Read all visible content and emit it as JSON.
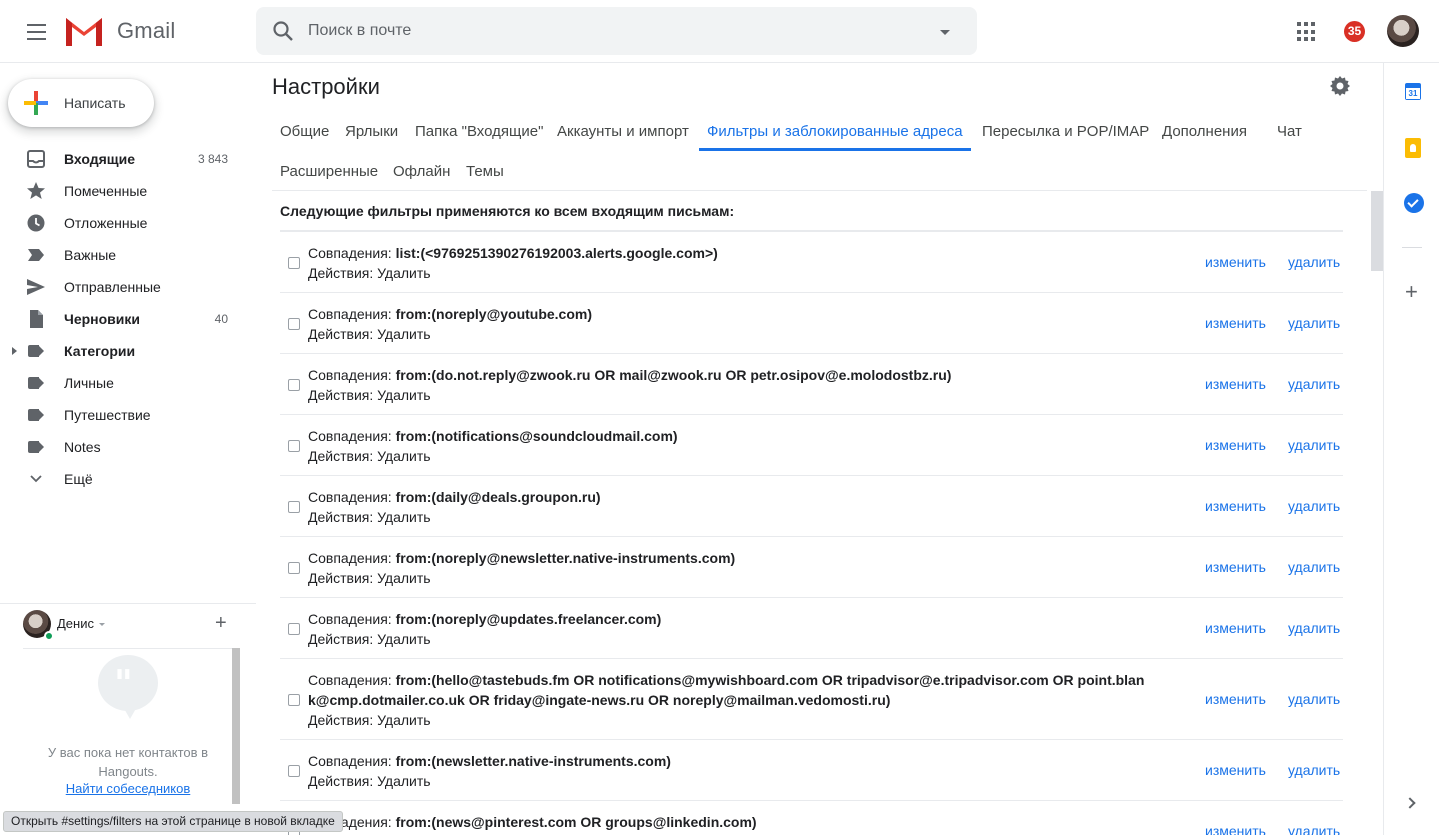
{
  "header": {
    "app_name": "Gmail",
    "search_placeholder": "Поиск в почте",
    "notifications_count": "35"
  },
  "sidebar": {
    "compose_label": "Написать",
    "items": [
      {
        "label": "Входящие",
        "count": "3 843",
        "icon": "inbox-icon",
        "bold": true
      },
      {
        "label": "Помеченные",
        "count": "",
        "icon": "star-icon"
      },
      {
        "label": "Отложенные",
        "count": "",
        "icon": "clock-icon"
      },
      {
        "label": "Важные",
        "count": "",
        "icon": "important-icon"
      },
      {
        "label": "Отправленные",
        "count": "",
        "icon": "send-icon"
      },
      {
        "label": "Черновики",
        "count": "40",
        "icon": "draft-icon",
        "bold": true
      },
      {
        "label": "Категории",
        "count": "",
        "icon": "label-icon",
        "bold": true
      },
      {
        "label": "Личные",
        "count": "",
        "icon": "label-icon"
      },
      {
        "label": "Путешествие",
        "count": "",
        "icon": "label-icon"
      },
      {
        "label": "Notes",
        "count": "",
        "icon": "label-icon"
      },
      {
        "label": "Ещё",
        "count": "",
        "icon": "chevron-down-icon"
      }
    ]
  },
  "hangouts": {
    "user_name": "Денис",
    "empty_text": "У вас пока нет контактов в Hangouts.",
    "find_link": "Найти собеседников"
  },
  "status_bar": "Открыть #settings/filters на этой странице в новой вкладке",
  "settings": {
    "title": "Настройки",
    "tabs": [
      {
        "label": "Общие"
      },
      {
        "label": "Ярлыки"
      },
      {
        "label": "Папка \"Входящие\""
      },
      {
        "label": "Аккаунты и импорт"
      },
      {
        "label": "Фильтры и заблокированные адреса",
        "active": true
      },
      {
        "label": "Пересылка и POP/IMAP"
      },
      {
        "label": "Дополнения"
      },
      {
        "label": "Чат"
      },
      {
        "label": "Расширенные"
      },
      {
        "label": "Офлайн"
      },
      {
        "label": "Темы"
      }
    ],
    "filters_heading": "Следующие фильтры применяются ко всем входящим письмам:",
    "match_label": "Совпадения: ",
    "action_label": "Действия: Удалить",
    "edit_label": "изменить",
    "delete_label": "удалить",
    "filters": [
      {
        "criteria": "list:(<9769251390276192003.alerts.google.com>)"
      },
      {
        "criteria": "from:(noreply@youtube.com)"
      },
      {
        "criteria": "from:(do.not.reply@zwook.ru OR mail@zwook.ru OR petr.osipov@e.molodostbz.ru)"
      },
      {
        "criteria": "from:(notifications@soundcloudmail.com)"
      },
      {
        "criteria": "from:(daily@deals.groupon.ru)"
      },
      {
        "criteria": "from:(noreply@newsletter.native-instruments.com)"
      },
      {
        "criteria": "from:(noreply@updates.freelancer.com)"
      },
      {
        "criteria": "from:(hello@tastebuds.fm OR notifications@mywishboard.com OR tripadvisor@e.tripadvisor.com OR point.blan k@cmp.dotmailer.co.uk OR friday@ingate-news.ru OR noreply@mailman.vedomosti.ru)"
      },
      {
        "criteria": "from:(newsletter.native-instruments.com)"
      },
      {
        "criteria": "from:(news@pinterest.com OR groups@linkedin.com)"
      }
    ]
  },
  "side_panel": {
    "calendar_day": "31"
  },
  "colors": {
    "accent": "#1a73e8",
    "badge": "#d93025",
    "text": "#202124"
  }
}
